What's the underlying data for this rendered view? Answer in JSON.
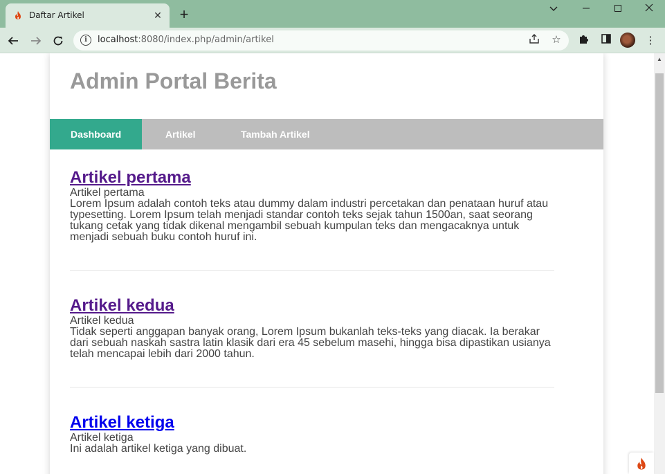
{
  "browser": {
    "tab": {
      "title": "Daftar Artikel"
    },
    "url": {
      "host": "localhost",
      "path": ":8080/index.php/admin/artikel"
    }
  },
  "page": {
    "site_title": "Admin Portal Berita",
    "nav": [
      {
        "label": "Dashboard"
      },
      {
        "label": "Artikel"
      },
      {
        "label": "Tambah Artikel"
      }
    ],
    "articles": [
      {
        "title": "Artikel pertama",
        "image_alt": "Artikel pertama",
        "body": "Lorem Ipsum adalah contoh teks atau dummy dalam industri percetakan dan penataan huruf atau typesetting. Lorem Ipsum telah menjadi standar contoh teks sejak tahun 1500an, saat seorang tukang cetak yang tidak dikenal mengambil sebuah kumpulan teks dan mengacaknya untuk menjadi sebuah buku contoh huruf ini."
      },
      {
        "title": "Artikel kedua",
        "image_alt": "Artikel kedua",
        "body": "Tidak seperti anggapan banyak orang, Lorem Ipsum bukanlah teks-teks yang diacak. Ia berakar dari sebuah naskah sastra latin klasik dari era 45 sebelum masehi, hingga bisa dipastikan usianya telah mencapai lebih dari 2000 tahun."
      },
      {
        "title": "Artikel ketiga",
        "image_alt": "Artikel ketiga",
        "body": "Ini adalah artikel ketiga yang dibuat."
      }
    ]
  },
  "colors": {
    "nav_active": "#33a98d",
    "nav_bg": "#bdbdbd",
    "link_visited": "#551a8b",
    "link": "#0000ee",
    "site_title": "#999999"
  },
  "icons": {
    "tab_favicon": "codeigniter-flame-icon",
    "debug_toolbar": "codeigniter-flame-icon"
  }
}
